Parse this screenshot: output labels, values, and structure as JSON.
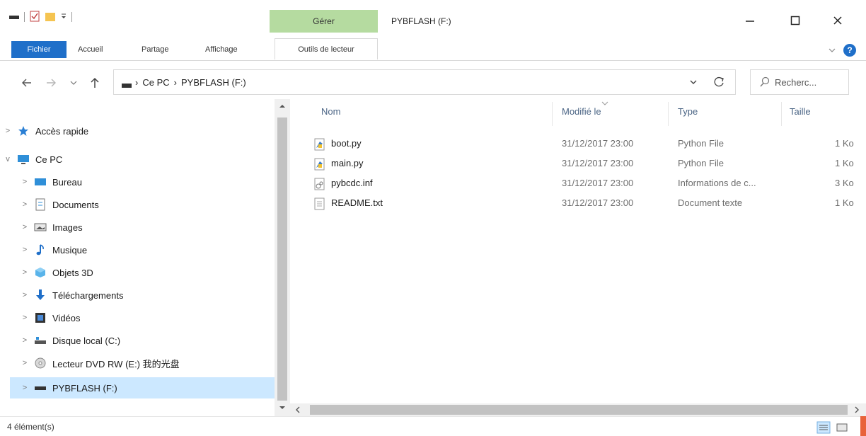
{
  "window": {
    "title": "PYBFLASH (F:)",
    "context_tab_header": "Gérer"
  },
  "ribbon": {
    "tabs": [
      "Fichier",
      "Accueil",
      "Partage",
      "Affichage",
      "Outils de lecteur"
    ],
    "help_label": "?"
  },
  "address": {
    "crumbs": [
      "Ce PC",
      "PYBFLASH (F:)"
    ]
  },
  "search": {
    "placeholder": "Recherc..."
  },
  "nav": {
    "items": [
      {
        "label": "Accès rapide",
        "icon": "star-icon",
        "level": 0,
        "chevron": ">"
      },
      {
        "label": "Ce PC",
        "icon": "computer-icon",
        "level": 0,
        "chevron": "v"
      },
      {
        "label": "Bureau",
        "icon": "desktop-icon",
        "level": 1,
        "chevron": ">"
      },
      {
        "label": "Documents",
        "icon": "document-folder-icon",
        "level": 1,
        "chevron": ">"
      },
      {
        "label": "Images",
        "icon": "pictures-icon",
        "level": 1,
        "chevron": ">"
      },
      {
        "label": "Musique",
        "icon": "music-icon",
        "level": 1,
        "chevron": ">"
      },
      {
        "label": "Objets 3D",
        "icon": "3d-objects-icon",
        "level": 1,
        "chevron": ">"
      },
      {
        "label": "Téléchargements",
        "icon": "download-icon",
        "level": 1,
        "chevron": ">"
      },
      {
        "label": "Vidéos",
        "icon": "video-icon",
        "level": 1,
        "chevron": ">"
      },
      {
        "label": "Disque local (C:)",
        "icon": "local-disk-icon",
        "level": 1,
        "chevron": ">"
      },
      {
        "label": "Lecteur DVD RW (E:) 我的光盘",
        "icon": "dvd-icon",
        "level": 1,
        "chevron": ">"
      },
      {
        "label": "PYBFLASH (F:)",
        "icon": "usb-drive-icon",
        "level": 1,
        "chevron": ">",
        "selected": true
      }
    ]
  },
  "filelist": {
    "columns": [
      "Nom",
      "Modifié le",
      "Type",
      "Taille"
    ],
    "rows": [
      {
        "name": "boot.py",
        "modified": "31/12/2017 23:00",
        "type": "Python File",
        "size": "1 Ko",
        "icon": "python-file-icon"
      },
      {
        "name": "main.py",
        "modified": "31/12/2017 23:00",
        "type": "Python File",
        "size": "1 Ko",
        "icon": "python-file-icon"
      },
      {
        "name": "pybcdc.inf",
        "modified": "31/12/2017 23:00",
        "type": "Informations de c...",
        "size": "3 Ko",
        "icon": "inf-file-icon"
      },
      {
        "name": "README.txt",
        "modified": "31/12/2017 23:00",
        "type": "Document texte",
        "size": "1 Ko",
        "icon": "text-file-icon"
      }
    ]
  },
  "status": {
    "count": "4 élément(s)"
  },
  "colors": {
    "accent": "#1f6fc9",
    "context_tab": "#b5dba0",
    "selection": "#cce8ff",
    "corner": "#e8623a"
  }
}
